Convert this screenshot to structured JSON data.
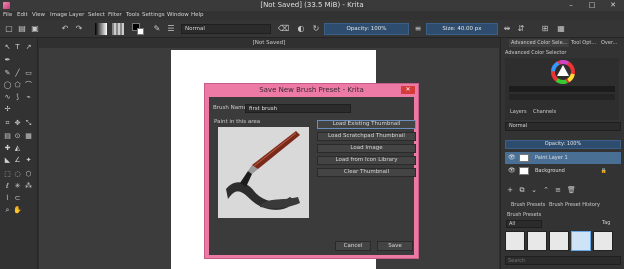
{
  "window": {
    "title": "[Not Saved]  (33.5 MiB)  - Krita",
    "controls": {
      "minimize": "–",
      "maximize": "□",
      "close": "✕"
    }
  },
  "menubar": [
    "File",
    "Edit",
    "View",
    "Image",
    "Layer",
    "Select",
    "Filter",
    "Tools",
    "Settings",
    "Window",
    "Help"
  ],
  "toolbar": {
    "blend_mode": "Normal",
    "opacity_label": "Opacity: 100%",
    "size_label": "Size: 40.00 px",
    "colors": {
      "foreground": "#000000",
      "background": "#ffffff"
    }
  },
  "document": {
    "tab_title": "[Not Saved]"
  },
  "dialog": {
    "title": "Save New Brush Preset - Krita",
    "close_label": "✕",
    "brush_name_label": "Brush Name:",
    "brush_name_value": "first brush",
    "paint_area_label": "Paint in this area",
    "buttons": [
      "Load Existing Thumbnail",
      "Load Scratchpad Thumbnail",
      "Load Image",
      "Load from Icon Library",
      "Clear Thumbnail"
    ],
    "cancel_label": "Cancel",
    "save_label": "Save"
  },
  "dock": {
    "top_tabs": [
      "Advanced Color Sele...",
      "Tool Opt...",
      "Over..."
    ],
    "color_selector_title": "Advanced Color Selector",
    "layer_tabs": [
      "Layers",
      "Channels"
    ],
    "blend_mode": "Normal",
    "opacity_label": "Opacity: 100%",
    "layers": [
      {
        "name": "Paint Layer 1",
        "selected": true
      },
      {
        "name": "Background",
        "selected": false
      }
    ],
    "preset_tabs": [
      "Brush Presets",
      "Brush Preset History"
    ],
    "presets_title": "Brush Presets",
    "presets_filter": "All",
    "tag_label": "Tag",
    "search_placeholder": "Search"
  },
  "colors": {
    "dialog_frame": "#ec7aa5",
    "accent": "#4a6f95"
  }
}
